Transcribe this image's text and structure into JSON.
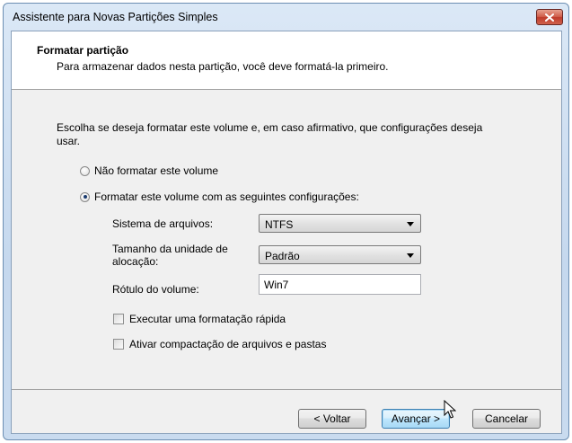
{
  "window": {
    "title": "Assistente para Novas Partições Simples"
  },
  "header": {
    "title": "Formatar partição",
    "subtitle": "Para armazenar dados nesta partição, você deve formatá-la primeiro."
  },
  "instructions": "Escolha se deseja formatar este volume e, em caso afirmativo, que configurações deseja usar.",
  "options": {
    "no_format": {
      "label": "Não formatar este volume",
      "selected": false
    },
    "format": {
      "label": "Formatar este volume com as seguintes configurações:",
      "selected": true
    }
  },
  "settings": {
    "filesystem": {
      "label": "Sistema de arquivos:",
      "value": "NTFS"
    },
    "allocation": {
      "label": "Tamanho da unidade de alocação:",
      "value": "Padrão"
    },
    "volume_label": {
      "label": "Rótulo do volume:",
      "value": "Win7"
    }
  },
  "checks": {
    "quick_format": {
      "label": "Executar uma formatação rápida",
      "checked": false
    },
    "compression": {
      "label": "Ativar compactação de arquivos e pastas",
      "checked": false
    }
  },
  "buttons": {
    "back": "< Voltar",
    "next": "Avançar >",
    "cancel": "Cancelar"
  },
  "colors": {
    "title_bar": "#c5d8ee",
    "close_button": "#c94a36",
    "default_button": "#3c7fb1"
  }
}
